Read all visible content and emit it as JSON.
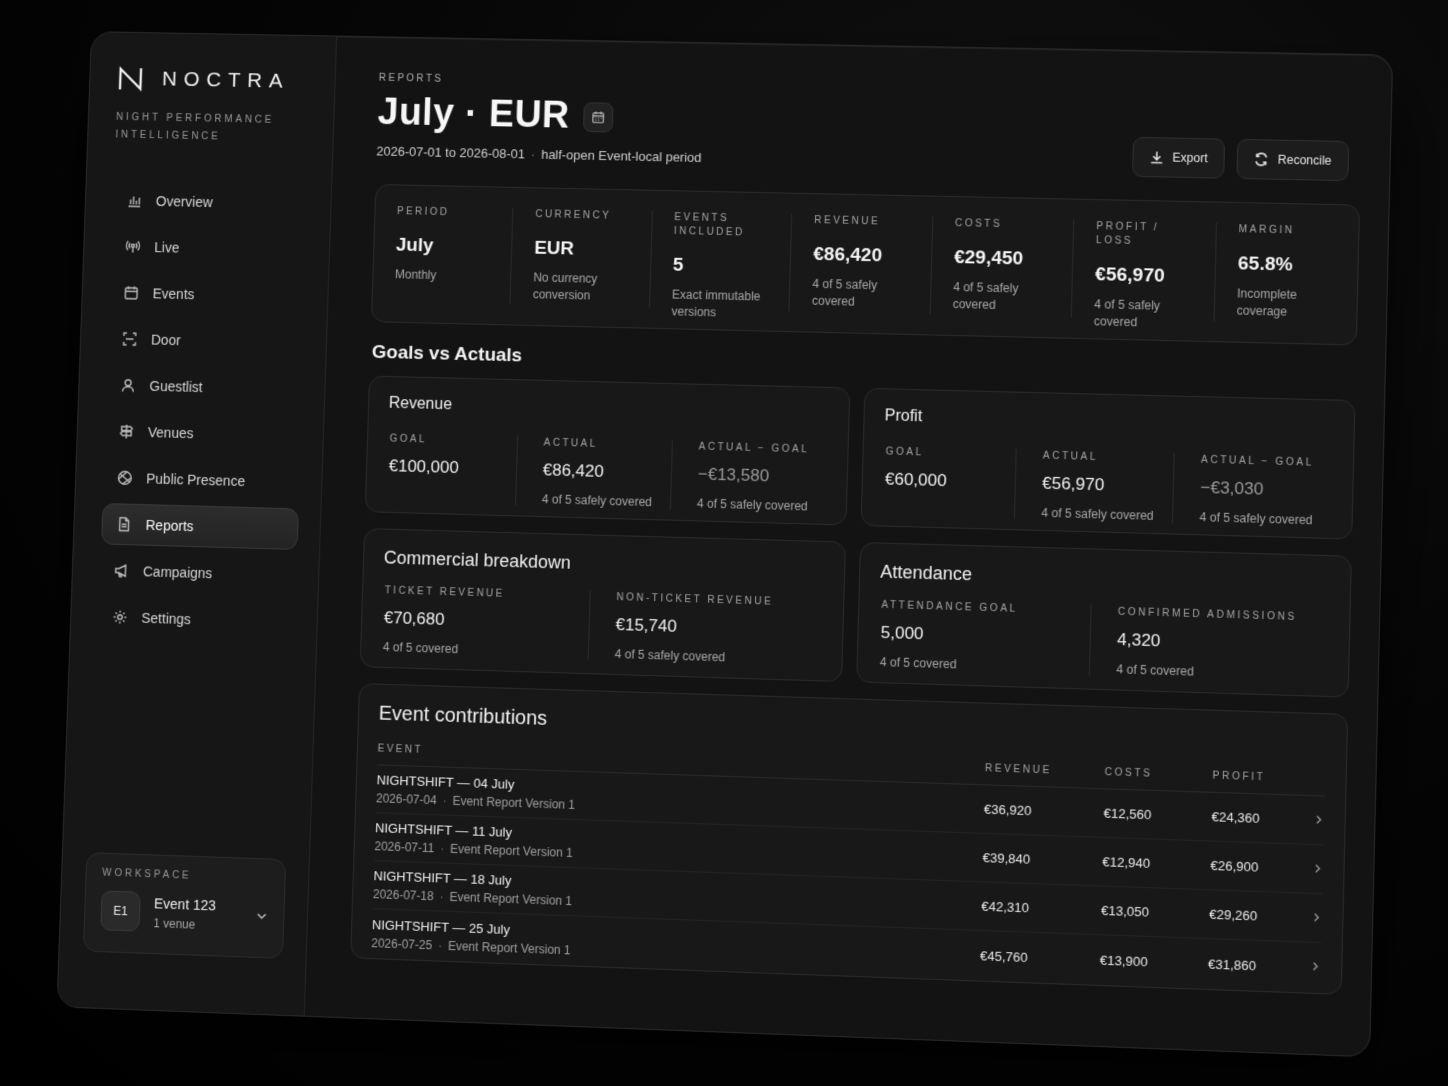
{
  "brand": {
    "name": "NOCTRA",
    "tagline": "Night Performance Intelligence"
  },
  "nav": [
    {
      "label": "Overview",
      "icon": "chart-icon"
    },
    {
      "label": "Live",
      "icon": "broadcast-icon"
    },
    {
      "label": "Events",
      "icon": "calendar-icon"
    },
    {
      "label": "Door",
      "icon": "door-scan-icon"
    },
    {
      "label": "Guestlist",
      "icon": "person-icon"
    },
    {
      "label": "Venues",
      "icon": "signpost-icon"
    },
    {
      "label": "Public Presence",
      "icon": "globe-icon"
    },
    {
      "label": "Reports",
      "icon": "document-icon",
      "active": true
    },
    {
      "label": "Campaigns",
      "icon": "megaphone-icon"
    },
    {
      "label": "Settings",
      "icon": "gear-icon"
    }
  ],
  "workspace": {
    "label": "Workspace",
    "badge": "E1",
    "name": "Event 123",
    "sub": "1 venue"
  },
  "header": {
    "eyebrow": "Reports",
    "title": "July · EUR",
    "range": "2026-07-01 to 2026-08-01",
    "period_note": "half-open Event-local period",
    "export_label": "Export",
    "reconcile_label": "Reconcile"
  },
  "summary": [
    {
      "label": "Period",
      "value": "July",
      "note": "Monthly"
    },
    {
      "label": "Currency",
      "value": "EUR",
      "note": "No currency conversion"
    },
    {
      "label": "Events included",
      "value": "5",
      "note": "Exact immutable versions"
    },
    {
      "label": "Revenue",
      "value": "€86,420",
      "note": "4 of 5 safely covered"
    },
    {
      "label": "Costs",
      "value": "€29,450",
      "note": "4 of 5 safely covered"
    },
    {
      "label": "Profit / loss",
      "value": "€56,970",
      "note": "4 of 5 safely covered"
    },
    {
      "label": "Margin",
      "value": "65.8%",
      "note": "Incomplete coverage"
    }
  ],
  "goals_title": "Goals vs Actuals",
  "goals": [
    {
      "title": "Revenue",
      "goal_label": "Goal",
      "goal": "€100,000",
      "actual_label": "Actual",
      "actual": "€86,420",
      "actual_note": "4 of 5 safely covered",
      "diff_label": "Actual − Goal",
      "diff": "−€13,580",
      "diff_note": "4 of 5 safely covered"
    },
    {
      "title": "Profit",
      "goal_label": "Goal",
      "goal": "€60,000",
      "actual_label": "Actual",
      "actual": "€56,970",
      "actual_note": "4 of 5 safely covered",
      "diff_label": "Actual − Goal",
      "diff": "−€3,030",
      "diff_note": "4 of 5 safely covered"
    }
  ],
  "commercial": {
    "title": "Commercial breakdown",
    "a_label": "Ticket revenue",
    "a_value": "€70,680",
    "a_note": "4 of 5 covered",
    "b_label": "Non-ticket revenue",
    "b_value": "€15,740",
    "b_note": "4 of 5 safely covered"
  },
  "attendance": {
    "title": "Attendance",
    "a_label": "Attendance goal",
    "a_value": "5,000",
    "a_note": "4 of 5 covered",
    "b_label": "Confirmed admissions",
    "b_value": "4,320",
    "b_note": "4 of 5 covered"
  },
  "contributions": {
    "title": "Event contributions",
    "columns": {
      "event": "Event",
      "revenue": "Revenue",
      "costs": "Costs",
      "profit": "Profit"
    },
    "rows": [
      {
        "name": "NIGHTSHIFT — 04 July",
        "date": "2026-07-04",
        "version": "Event Report Version 1",
        "revenue": "€36,920",
        "costs": "€12,560",
        "profit": "€24,360"
      },
      {
        "name": "NIGHTSHIFT — 11 July",
        "date": "2026-07-11",
        "version": "Event Report Version 1",
        "revenue": "€39,840",
        "costs": "€12,940",
        "profit": "€26,900"
      },
      {
        "name": "NIGHTSHIFT — 18 July",
        "date": "2026-07-18",
        "version": "Event Report Version 1",
        "revenue": "€42,310",
        "costs": "€13,050",
        "profit": "€29,260"
      },
      {
        "name": "NIGHTSHIFT — 25 July",
        "date": "2026-07-25",
        "version": "Event Report Version 1",
        "revenue": "€45,760",
        "costs": "€13,900",
        "profit": "€31,860"
      }
    ]
  }
}
